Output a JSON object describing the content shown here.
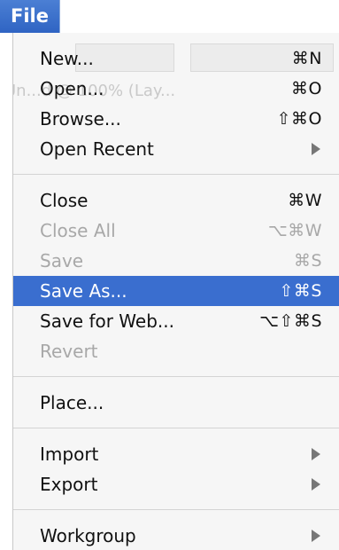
{
  "menu": {
    "title": "File",
    "background_text": "Un...d @ 100% (Lay...",
    "groups": [
      [
        {
          "label": "New...",
          "shortcut": "⌘N",
          "state": "enabled"
        },
        {
          "label": "Open...",
          "shortcut": "⌘O",
          "state": "enabled"
        },
        {
          "label": "Browse...",
          "shortcut": "⇧⌘O",
          "state": "enabled"
        },
        {
          "label": "Open Recent",
          "shortcut": "",
          "state": "enabled",
          "submenu": true
        }
      ],
      [
        {
          "label": "Close",
          "shortcut": "⌘W",
          "state": "enabled"
        },
        {
          "label": "Close All",
          "shortcut": "⌥⌘W",
          "state": "disabled"
        },
        {
          "label": "Save",
          "shortcut": "⌘S",
          "state": "disabled"
        },
        {
          "label": "Save As...",
          "shortcut": "⇧⌘S",
          "state": "selected"
        },
        {
          "label": "Save for Web...",
          "shortcut": "⌥⇧⌘S",
          "state": "enabled"
        },
        {
          "label": "Revert",
          "shortcut": "",
          "state": "disabled"
        }
      ],
      [
        {
          "label": "Place...",
          "shortcut": "",
          "state": "enabled"
        }
      ],
      [
        {
          "label": "Import",
          "shortcut": "",
          "state": "enabled",
          "submenu": true
        },
        {
          "label": "Export",
          "shortcut": "",
          "state": "enabled",
          "submenu": true
        }
      ],
      [
        {
          "label": "Workgroup",
          "shortcut": "",
          "state": "enabled",
          "submenu": true
        }
      ]
    ]
  },
  "colors": {
    "menu_title_bg": "#3a6ecf",
    "selected_bg": "#3a6ecf",
    "disabled_text": "#a8a8a8"
  }
}
